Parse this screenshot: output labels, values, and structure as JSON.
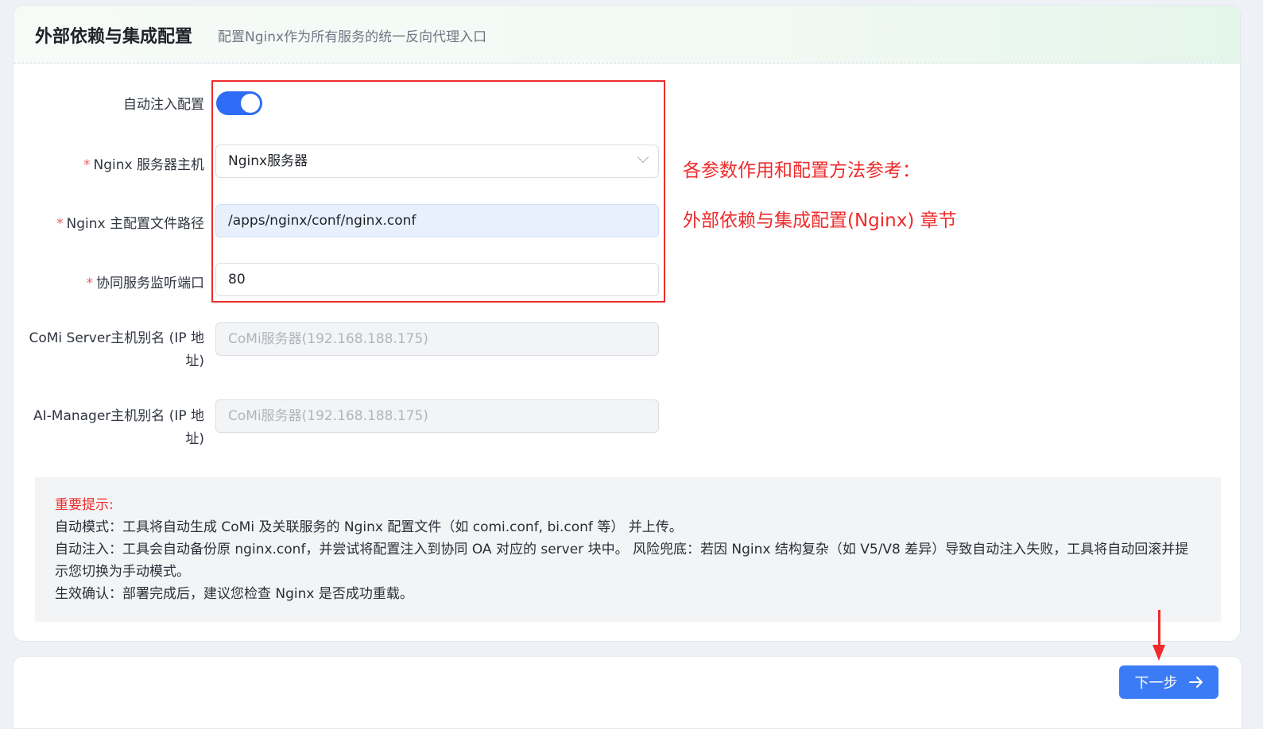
{
  "header": {
    "title": "外部依赖与集成配置",
    "subtitle": "配置Nginx作为所有服务的统一反向代理入口"
  },
  "form": {
    "auto_inject": {
      "label": "自动注入配置",
      "enabled": true
    },
    "nginx_host": {
      "required_mark": "*",
      "label": "Nginx 服务器主机",
      "value": "Nginx服务器"
    },
    "nginx_conf_path": {
      "required_mark": "*",
      "label": "Nginx 主配置文件路径",
      "value": "/apps/nginx/conf/nginx.conf"
    },
    "listen_port": {
      "required_mark": "*",
      "label": "协同服务监听端口",
      "value": "80"
    },
    "comi_alias": {
      "label": "CoMi Server主机别名 (IP 地址)",
      "placeholder": "CoMi服务器(192.168.188.175)"
    },
    "aimanager_alias": {
      "label": "AI-Manager主机别名 (IP 地址)",
      "placeholder": "CoMi服务器(192.168.188.175)"
    }
  },
  "annotation": {
    "line1": "各参数作用和配置方法参考：",
    "line2": "外部依赖与集成配置(Nginx) 章节"
  },
  "notice": {
    "title": "重要提示:",
    "lines": [
      "自动模式：工具将自动生成 CoMi 及关联服务的 Nginx 配置文件（如 comi.conf, bi.conf 等） 并上传。",
      "自动注入：工具会自动备份原 nginx.conf，并尝试将配置注入到协同 OA 对应的 server 块中。 风险兜底：若因 Nginx 结构复杂（如 V5/V8 差异）导致自动注入失败，工具将自动回滚并提示您切换为手动模式。",
      "生效确认：部署完成后，建议您检查 Nginx 是否成功重载。"
    ]
  },
  "footer": {
    "next_label": "下一步",
    "next_icon": "arrow-right-icon"
  },
  "colors": {
    "primary": "#3b7cf6",
    "annotation_red": "#ee2b2b",
    "toggle_on": "#2f6cf5"
  }
}
